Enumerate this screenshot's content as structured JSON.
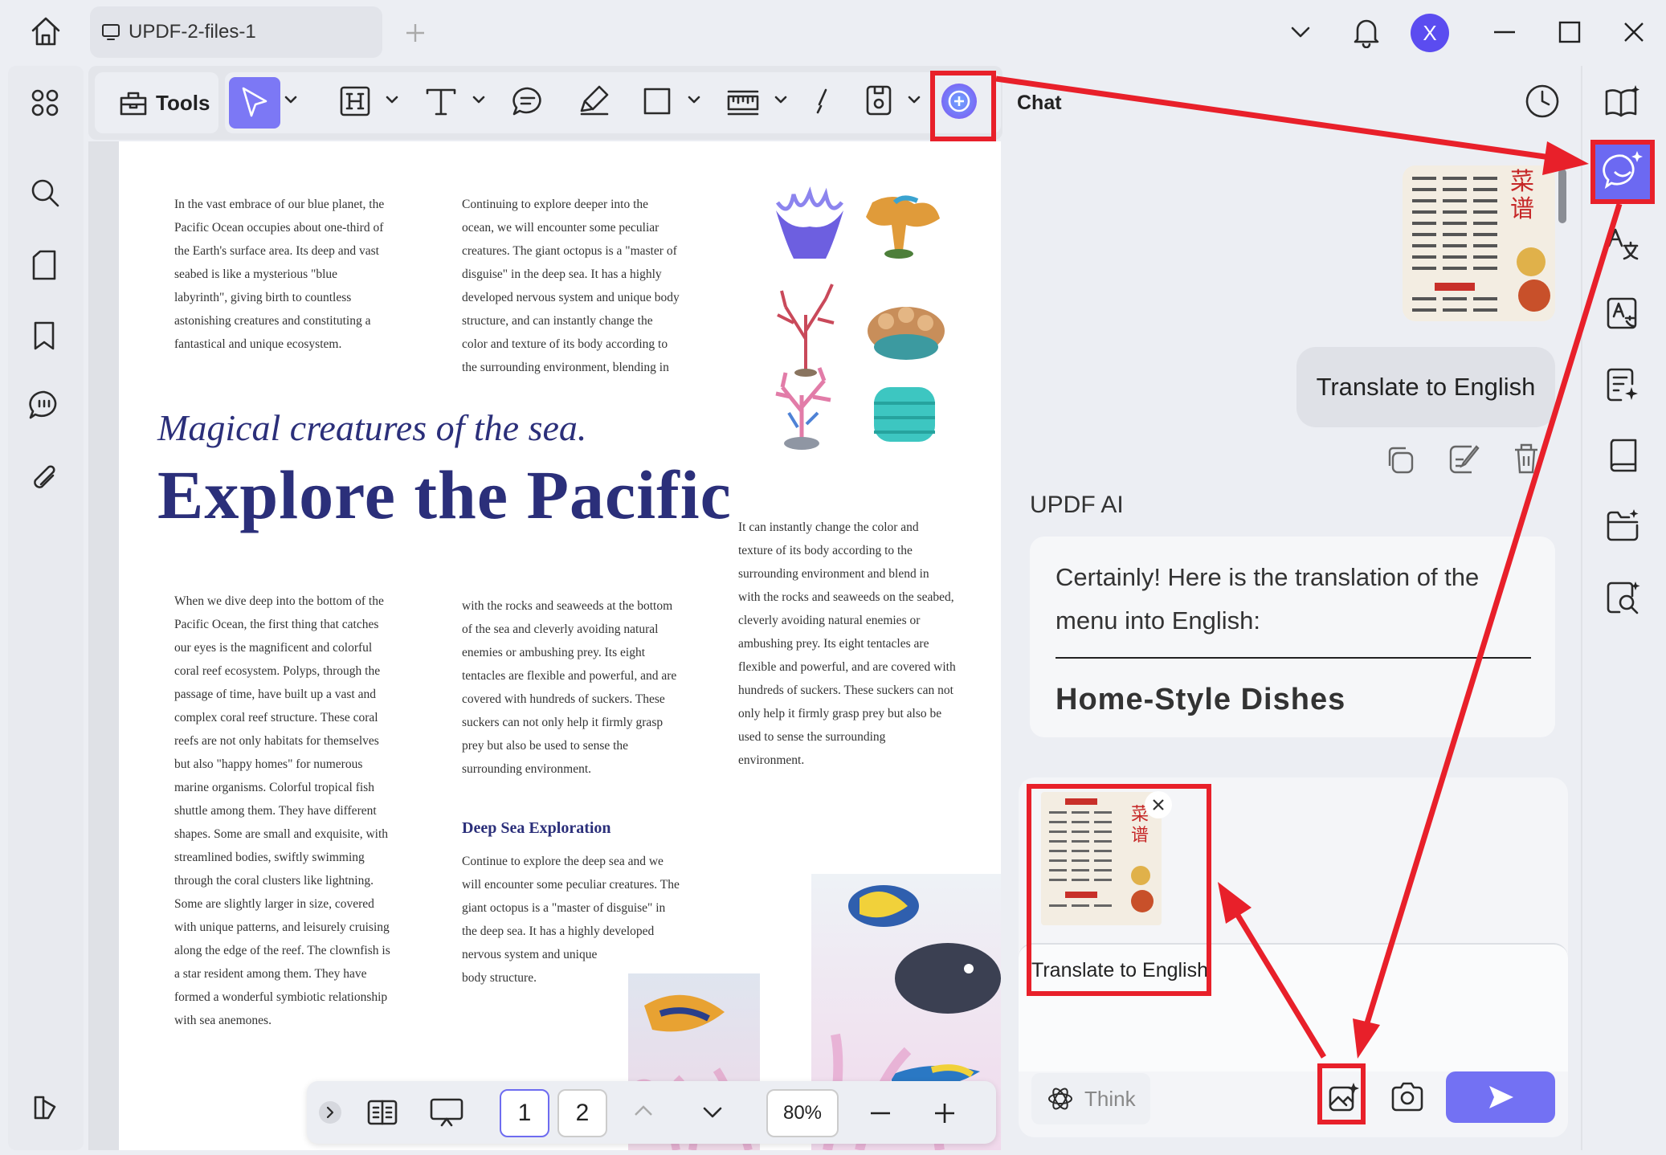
{
  "window": {
    "tab_title": "UPDF-2-files-1",
    "avatar_letter": "X"
  },
  "toolbar": {
    "tools_label": "Tools"
  },
  "document": {
    "col1_top": [
      "In the vast embrace of our blue planet, the",
      "Pacific Ocean occupies about one-third of",
      "the Earth's surface area. Its deep and vast",
      "seabed is like a mysterious \"blue",
      "labyrinth\", giving birth to countless",
      "astonishing creatures and constituting a",
      "fantastical and unique ecosystem."
    ],
    "col2_top": [
      "Continuing to explore deeper into the",
      "ocean, we will encounter some peculiar",
      "creatures. The giant octopus is a \"master of",
      "disguise\" in the deep sea. It has a highly",
      "developed nervous system and unique body",
      "structure, and can instantly change the",
      "color and texture of its body according to",
      "the surrounding environment, blending in"
    ],
    "subtitle": "Magical creatures of the sea.",
    "title": "Explore the Pacific",
    "col3_mid": [
      "It can instantly change the color and",
      "texture of its body according to the",
      "surrounding environment and blend in",
      "with the rocks and seaweeds on the seabed,",
      "cleverly avoiding natural enemies or",
      "ambushing prey. Its eight tentacles are",
      "flexible and powerful, and are covered with",
      "hundreds of suckers. These suckers can not",
      "only help it firmly grasp prey but also be",
      "used to sense the surrounding",
      "environment."
    ],
    "col1_bottom": [
      "When we dive deep into the bottom of the",
      "Pacific Ocean, the first thing that catches",
      "our eyes is the magnificent and colorful",
      "coral reef ecosystem. Polyps, through the",
      "passage of time, have built up a vast and",
      "complex coral reef structure. These coral",
      "reefs are not only habitats for themselves",
      "but also \"happy homes\" for numerous",
      "marine organisms. Colorful tropical fish",
      "shuttle among them. They have different",
      "shapes. Some are small and exquisite, with",
      "streamlined bodies, swiftly swimming",
      "through the coral clusters like lightning.",
      "Some are slightly larger in size, covered",
      "with unique patterns, and leisurely cruising",
      "along the edge of the reef. The clownfish is",
      "a star resident among them. They have",
      "formed a wonderful symbiotic relationship",
      "with sea anemones."
    ],
    "col2_bottom": [
      "with the rocks and seaweeds at the bottom",
      "of the sea and cleverly avoiding natural",
      "enemies or ambushing prey. Its eight",
      "tentacles are flexible and powerful, and are",
      "covered with hundreds of suckers. These",
      "suckers can not only help it firmly grasp",
      "prey but also be used to sense the",
      "surrounding environment."
    ],
    "deep_sea_heading": "Deep Sea Exploration",
    "deep_sea_text": [
      "Continue to explore the deep sea and we",
      "will encounter some peculiar creatures. The",
      "giant octopus is a \"master of disguise\" in",
      "the deep sea. It has a highly developed",
      "nervous system and unique",
      "body structure."
    ]
  },
  "bottom_nav": {
    "page1": "1",
    "page2": "2",
    "zoom": "80%"
  },
  "chat": {
    "title": "Chat",
    "user_message": "Translate to English",
    "image_text_title": "菜谱",
    "ai_label": "UPDF AI",
    "ai_response": "Certainly! Here is the translation of the menu into English:",
    "ai_heading": "Home-Style Dishes",
    "input_attachment_text": "Translate to English",
    "think_label": "Think"
  },
  "colors": {
    "accent": "#7371f3",
    "highlight": "#e8202a",
    "title": "#2b2f7a"
  }
}
